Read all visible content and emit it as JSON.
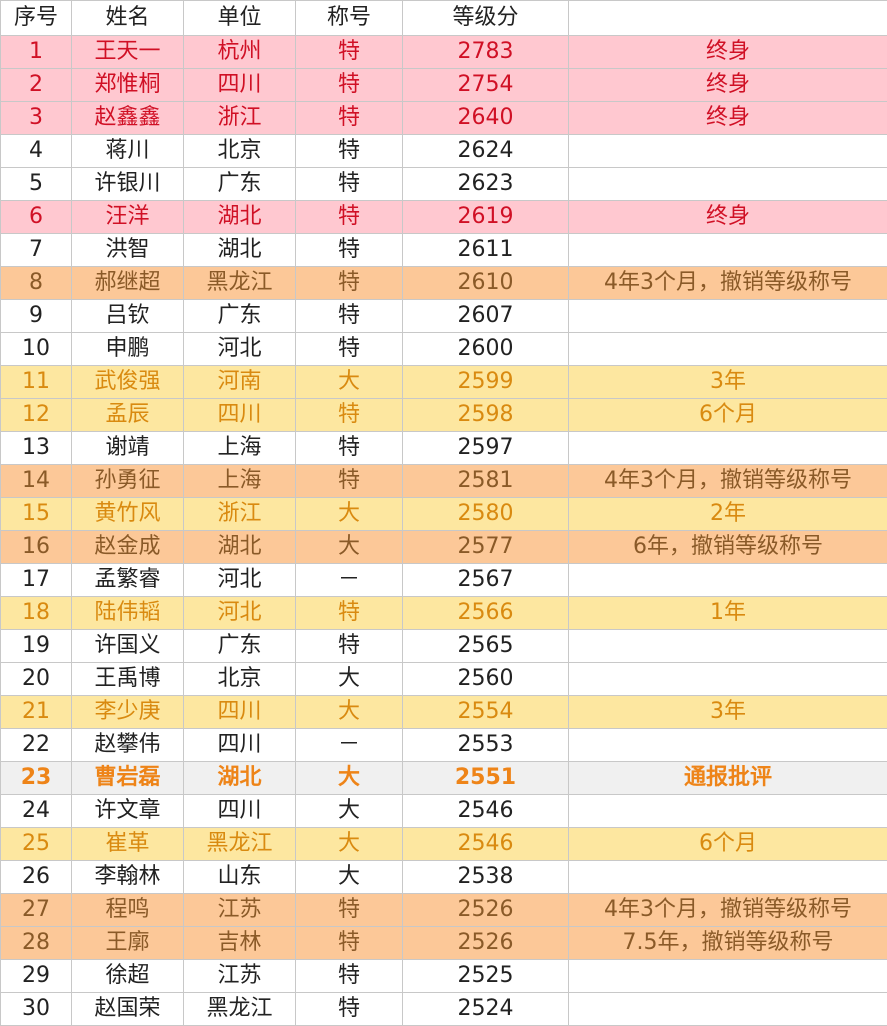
{
  "headers": [
    "序号",
    "姓名",
    "单位",
    "称号",
    "等级分",
    ""
  ],
  "rows": [
    {
      "no": "1",
      "name": "王天一",
      "unit": "杭州",
      "title": "特",
      "score": "2783",
      "note": "终身",
      "style": "pink"
    },
    {
      "no": "2",
      "name": "郑惟桐",
      "unit": "四川",
      "title": "特",
      "score": "2754",
      "note": "终身",
      "style": "pink"
    },
    {
      "no": "3",
      "name": "赵鑫鑫",
      "unit": "浙江",
      "title": "特",
      "score": "2640",
      "note": "终身",
      "style": "pink"
    },
    {
      "no": "4",
      "name": "蒋川",
      "unit": "北京",
      "title": "特",
      "score": "2624",
      "note": "",
      "style": "white"
    },
    {
      "no": "5",
      "name": "许银川",
      "unit": "广东",
      "title": "特",
      "score": "2623",
      "note": "",
      "style": "white"
    },
    {
      "no": "6",
      "name": "汪洋",
      "unit": "湖北",
      "title": "特",
      "score": "2619",
      "note": "终身",
      "style": "pink"
    },
    {
      "no": "7",
      "name": "洪智",
      "unit": "湖北",
      "title": "特",
      "score": "2611",
      "note": "",
      "style": "white"
    },
    {
      "no": "8",
      "name": "郝继超",
      "unit": "黑龙江",
      "title": "特",
      "score": "2610",
      "note": "4年3个月，撤销等级称号",
      "style": "orange"
    },
    {
      "no": "9",
      "name": "吕钦",
      "unit": "广东",
      "title": "特",
      "score": "2607",
      "note": "",
      "style": "white"
    },
    {
      "no": "10",
      "name": "申鹏",
      "unit": "河北",
      "title": "特",
      "score": "2600",
      "note": "",
      "style": "white"
    },
    {
      "no": "11",
      "name": "武俊强",
      "unit": "河南",
      "title": "大",
      "score": "2599",
      "note": "3年",
      "style": "yellow"
    },
    {
      "no": "12",
      "name": "孟辰",
      "unit": "四川",
      "title": "特",
      "score": "2598",
      "note": "6个月",
      "style": "yellow"
    },
    {
      "no": "13",
      "name": "谢靖",
      "unit": "上海",
      "title": "特",
      "score": "2597",
      "note": "",
      "style": "white"
    },
    {
      "no": "14",
      "name": "孙勇征",
      "unit": "上海",
      "title": "特",
      "score": "2581",
      "note": "4年3个月，撤销等级称号",
      "style": "orange"
    },
    {
      "no": "15",
      "name": "黄竹风",
      "unit": "浙江",
      "title": "大",
      "score": "2580",
      "note": "2年",
      "style": "yellow"
    },
    {
      "no": "16",
      "name": "赵金成",
      "unit": "湖北",
      "title": "大",
      "score": "2577",
      "note": "6年，撤销等级称号",
      "style": "orange"
    },
    {
      "no": "17",
      "name": "孟繁睿",
      "unit": "河北",
      "title": "－",
      "score": "2567",
      "note": "",
      "style": "white"
    },
    {
      "no": "18",
      "name": "陆伟韬",
      "unit": "河北",
      "title": "特",
      "score": "2566",
      "note": "1年",
      "style": "yellow"
    },
    {
      "no": "19",
      "name": "许国义",
      "unit": "广东",
      "title": "特",
      "score": "2565",
      "note": "",
      "style": "white"
    },
    {
      "no": "20",
      "name": "王禹博",
      "unit": "北京",
      "title": "大",
      "score": "2560",
      "note": "",
      "style": "white"
    },
    {
      "no": "21",
      "name": "李少庚",
      "unit": "四川",
      "title": "大",
      "score": "2554",
      "note": "3年",
      "style": "yellow"
    },
    {
      "no": "22",
      "name": "赵攀伟",
      "unit": "四川",
      "title": "－",
      "score": "2553",
      "note": "",
      "style": "white"
    },
    {
      "no": "23",
      "name": "曹岩磊",
      "unit": "湖北",
      "title": "大",
      "score": "2551",
      "note": "通报批评",
      "style": "grey"
    },
    {
      "no": "24",
      "name": "许文章",
      "unit": "四川",
      "title": "大",
      "score": "2546",
      "note": "",
      "style": "white"
    },
    {
      "no": "25",
      "name": "崔革",
      "unit": "黑龙江",
      "title": "大",
      "score": "2546",
      "note": "6个月",
      "style": "yellow"
    },
    {
      "no": "26",
      "name": "李翰林",
      "unit": "山东",
      "title": "大",
      "score": "2538",
      "note": "",
      "style": "white"
    },
    {
      "no": "27",
      "name": "程鸣",
      "unit": "江苏",
      "title": "特",
      "score": "2526",
      "note": "4年3个月，撤销等级称号",
      "style": "orange"
    },
    {
      "no": "28",
      "name": "王廓",
      "unit": "吉林",
      "title": "特",
      "score": "2526",
      "note": "7.5年，撤销等级称号",
      "style": "orange"
    },
    {
      "no": "29",
      "name": "徐超",
      "unit": "江苏",
      "title": "特",
      "score": "2525",
      "note": "",
      "style": "white"
    },
    {
      "no": "30",
      "name": "赵国荣",
      "unit": "黑龙江",
      "title": "特",
      "score": "2524",
      "note": "",
      "style": "white"
    }
  ],
  "colors": {
    "pink": "#ffc8d0",
    "pink_text": "#d01025",
    "orange": "#fcc898",
    "orange_text": "#8a5a28",
    "yellow": "#fde7a0",
    "yellow_text": "#d98a10",
    "grey": "#f0f0f0",
    "grey_text": "#ee8418"
  }
}
